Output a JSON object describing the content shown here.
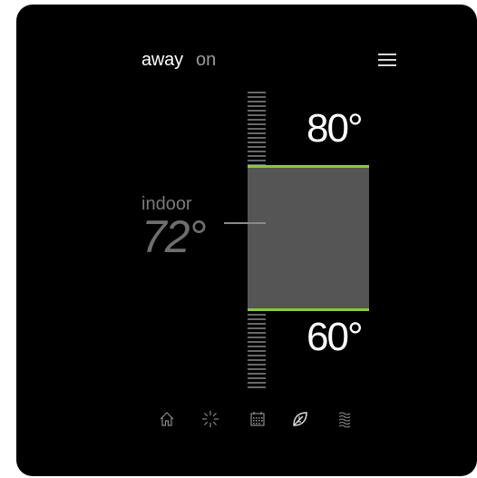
{
  "header": {
    "away_label": "away",
    "away_state": "on"
  },
  "setpoints": {
    "high": "80°",
    "low": "60°"
  },
  "indoor": {
    "label": "indoor",
    "temp": "72°"
  },
  "colors": {
    "background": "#000000",
    "range_fill": "#555555",
    "accent": "#8cc63f"
  },
  "nav": {
    "items": [
      {
        "icon": "home-icon"
      },
      {
        "icon": "fan-icon"
      },
      {
        "icon": "calendar-icon"
      },
      {
        "icon": "leaf-icon"
      },
      {
        "icon": "waves-icon"
      }
    ]
  }
}
